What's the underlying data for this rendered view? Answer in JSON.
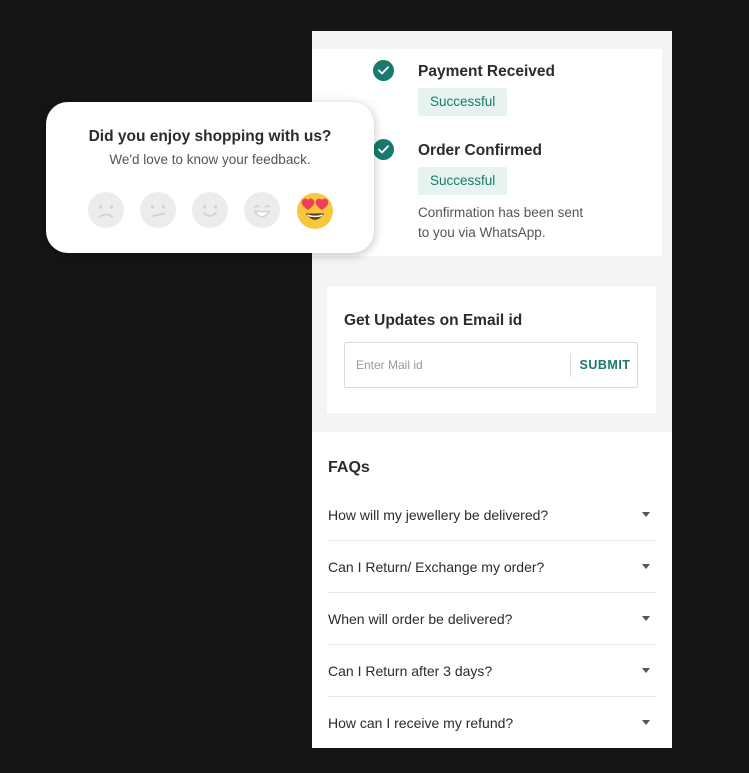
{
  "order_status": {
    "steps": [
      {
        "title": "Payment Received",
        "status": "Successful",
        "note": ""
      },
      {
        "title": "Order Confirmed",
        "status": "Successful",
        "note": "Confirmation has been sent to you via WhatsApp."
      }
    ]
  },
  "email_updates": {
    "title": "Get Updates on Email id",
    "placeholder": "Enter Mail id",
    "value": "",
    "submit_label": "SUBMIT"
  },
  "faqs": {
    "heading": "FAQs",
    "items": [
      "How will my jewellery be delivered?",
      "Can I Return/ Exchange my order?",
      "When will order be delivered?",
      "Can I Return after 3 days?",
      "How can I receive my refund?"
    ]
  },
  "feedback": {
    "title": "Did you enjoy shopping with us?",
    "subtitle": "We'd love to know your feedback.",
    "ratings": [
      "sad-face-icon",
      "confused-face-icon",
      "smile-face-icon",
      "grin-face-icon",
      "heart-eyes-face-icon"
    ],
    "selected_rating": 5
  },
  "colors": {
    "accent": "#187a6c",
    "success_bg": "#e6f3f0",
    "background": "#151515",
    "emoji_selected": "#f9c63c",
    "emoji_inactive": "#ececec"
  }
}
